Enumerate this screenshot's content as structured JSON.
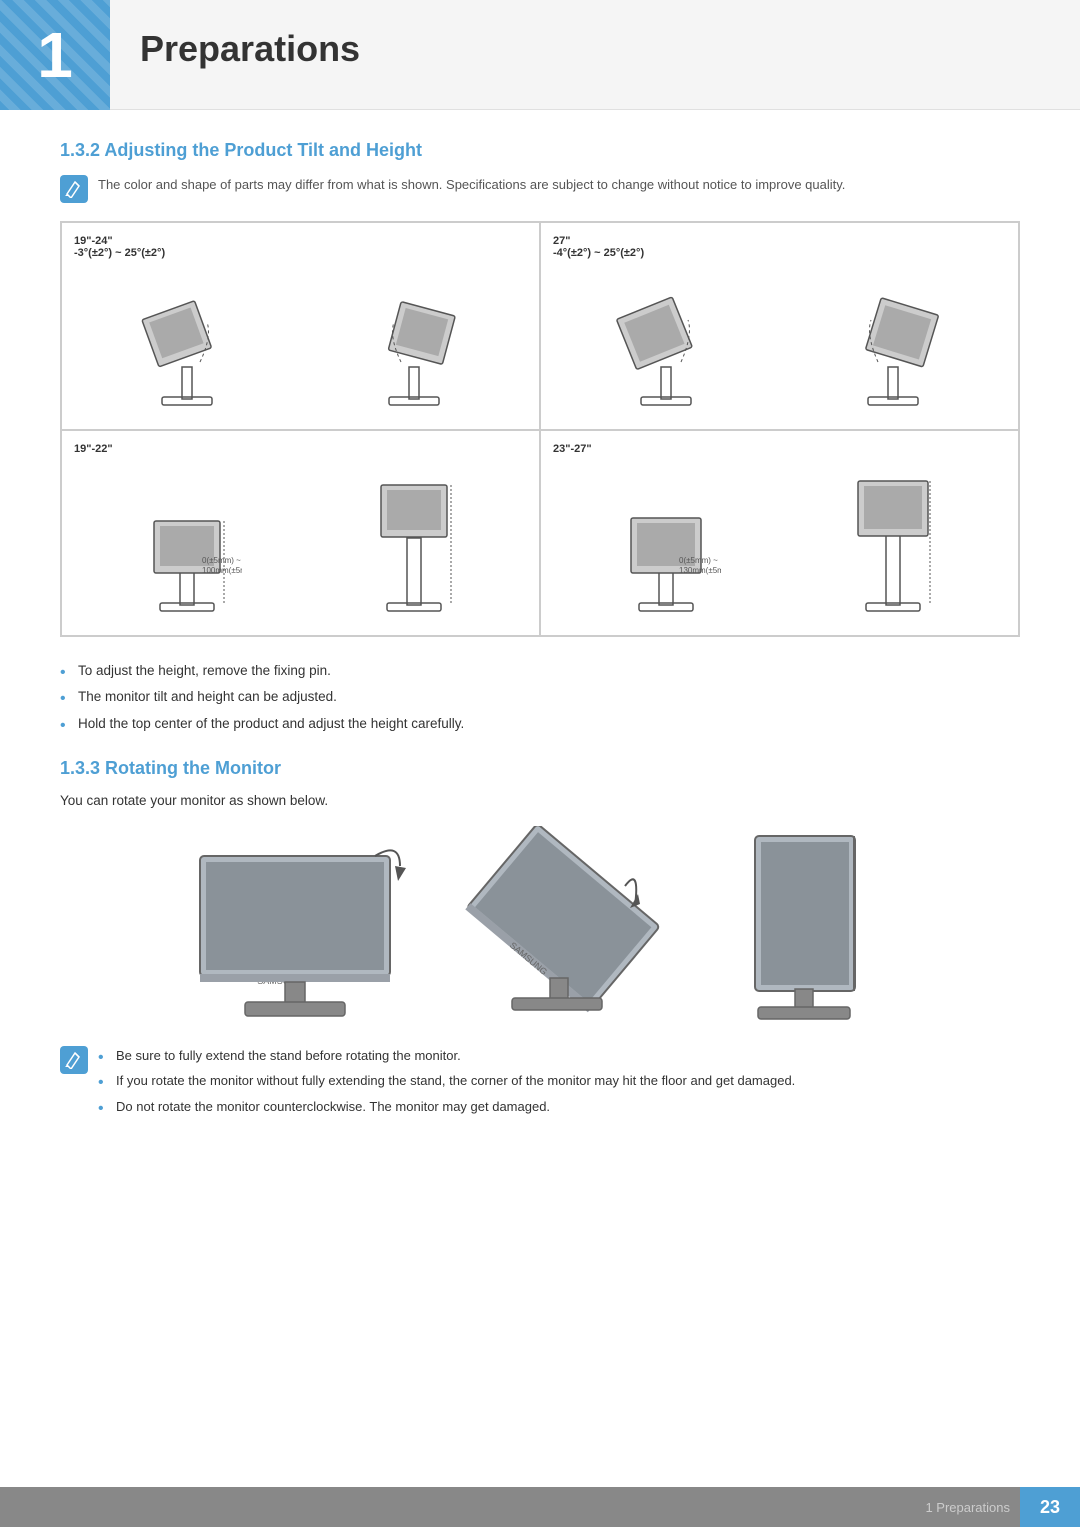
{
  "header": {
    "chapter_number": "1",
    "title": "Preparations"
  },
  "section_132": {
    "heading": "1.3.2   Adjusting the Product Tilt and Height",
    "note": "The color and shape of parts may differ from what is shown. Specifications are subject to change without notice to improve quality.",
    "diagrams": [
      {
        "label": "19\"-24\"",
        "sublabel": "-3°(±2°) ~ 25°(±2°)"
      },
      {
        "label": "27\"",
        "sublabel": "-4°(±2°) ~ 25°(±2°)"
      },
      {
        "label": "19\"-22\"",
        "sublabel": ""
      },
      {
        "label": "23\"-27\"",
        "sublabel": ""
      }
    ],
    "bullets": [
      "To adjust the height, remove the fixing pin.",
      "The monitor tilt and height can be adjusted.",
      "Hold the top center of the product and adjust the height carefully."
    ]
  },
  "section_133": {
    "heading": "1.3.3   Rotating the Monitor",
    "description": "You can rotate your monitor as shown below.",
    "note_bullets": [
      "Be sure to fully extend the stand before rotating the monitor.",
      "If you rotate the monitor without fully extending the stand, the corner of the monitor may hit the floor and get damaged.",
      "Do not rotate the monitor counterclockwise. The monitor may get damaged."
    ]
  },
  "footer": {
    "text": "1 Preparations",
    "page": "23"
  },
  "icons": {
    "note": "✎"
  }
}
